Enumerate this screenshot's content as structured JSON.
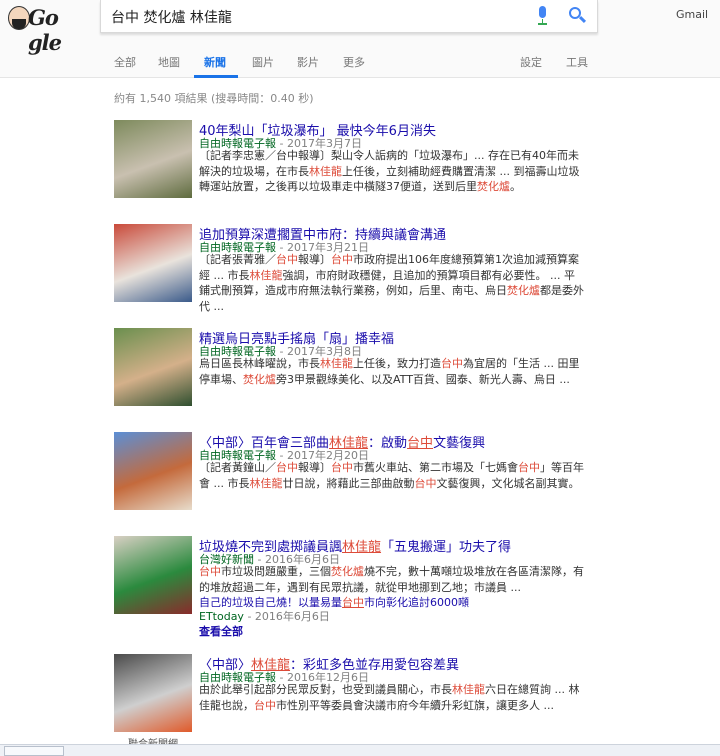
{
  "logo": {
    "text": "Go gle"
  },
  "search": {
    "query": "台中 焚化爐 林佳龍"
  },
  "header": {
    "gmail": "Gmail"
  },
  "tabs": {
    "all": "全部",
    "maps": "地圖",
    "news": "新聞",
    "images": "圖片",
    "videos": "影片",
    "more": "更多",
    "settings": "設定",
    "tools": "工具"
  },
  "stats": "約有 1,540 項結果 (搜尋時間：0.40 秒)",
  "results": [
    {
      "title": "40年梨山「垃圾瀑布」 最快今年6月消失",
      "source": "自由時報電子報",
      "date": "- 2017年3月7日",
      "snippet": [
        {
          "t": "〔記者李忠憲／台中報導〕梨山令人詬病的「垃圾瀑布」... 存在已有40年而未解決的垃圾場，在市長"
        },
        {
          "t": "林佳龍",
          "hl": true
        },
        {
          "t": "上任後，立刻補助經費購置清潔 ... 到福壽山垃圾轉運站放置，之後再以垃圾車走中橫隧37便道，送到后里"
        },
        {
          "t": "焚化爐",
          "hl": true
        },
        {
          "t": "。"
        }
      ],
      "thumb_colors": [
        "#7d8a5c",
        "#c9c0b0",
        "#5e6b3e"
      ]
    },
    {
      "title": "追加預算深遭擱置中市府：持續與議會溝通",
      "source": "自由時報電子報",
      "date": "- 2017年3月21日",
      "snippet": [
        {
          "t": "〔記者張菁雅／"
        },
        {
          "t": "台中",
          "hl": true
        },
        {
          "t": "報導〕"
        },
        {
          "t": "台中",
          "hl": true
        },
        {
          "t": "市政府提出106年度總預算第1次追加減預算案經 ... 市長"
        },
        {
          "t": "林佳龍",
          "hl": true
        },
        {
          "t": "強調，市府財政穩健，且追加的預算項目都有必要性。 ... 平鋪式刪預算，造成市府無法執行業務，例如，后里、南屯、烏日"
        },
        {
          "t": "焚化爐",
          "hl": true
        },
        {
          "t": "都是委外代 ..."
        }
      ],
      "thumb_colors": [
        "#c94a3a",
        "#e9e3dc",
        "#3a5a8a"
      ]
    },
    {
      "title": "精選烏日亮點手搖扇「扇」播幸福",
      "source": "自由時報電子報",
      "date": "- 2017年3月8日",
      "snippet": [
        {
          "t": "烏日區長林峰曜說，市長"
        },
        {
          "t": "林佳龍",
          "hl": true
        },
        {
          "t": "上任後，致力打造"
        },
        {
          "t": "台中",
          "hl": true
        },
        {
          "t": "為宜居的「生活 ... 田里停車場、"
        },
        {
          "t": "焚化爐",
          "hl": true
        },
        {
          "t": "旁3甲景觀綠美化、以及ATT百貨、國泰、新光人壽、烏日 ..."
        }
      ],
      "thumb_colors": [
        "#6a8f4e",
        "#d4b08a",
        "#2f4f2f"
      ]
    },
    {
      "title_parts": [
        {
          "t": "〈中部〉百年會三部曲"
        },
        {
          "t": "林佳龍",
          "ul": true
        },
        {
          "t": "：啟動"
        },
        {
          "t": "台中",
          "ul": true
        },
        {
          "t": "文藝復興"
        }
      ],
      "source": "自由時報電子報",
      "date": "- 2017年2月20日",
      "snippet": [
        {
          "t": "〔記者黃鐘山／"
        },
        {
          "t": "台中",
          "hl": true
        },
        {
          "t": "報導〕"
        },
        {
          "t": "台中",
          "hl": true
        },
        {
          "t": "市舊火車站、第二市場及「七媽會"
        },
        {
          "t": "台中",
          "hl": true
        },
        {
          "t": "」等百年會 ... 市長"
        },
        {
          "t": "林佳龍",
          "hl": true
        },
        {
          "t": "廿日說，將藉此三部曲啟動"
        },
        {
          "t": "台中",
          "hl": true
        },
        {
          "t": "文藝復興，文化城名副其實。"
        }
      ],
      "thumb_colors": [
        "#5b8fd6",
        "#c46a3c",
        "#e7dccb"
      ]
    },
    {
      "title_parts": [
        {
          "t": "垃圾燒不完到處掷議員諷"
        },
        {
          "t": "林佳龍",
          "ul": true
        },
        {
          "t": "「五鬼搬運」功夫了得"
        }
      ],
      "source": "台灣好新聞",
      "date": "- 2016年6月6日",
      "snippet": [
        {
          "t": "台中",
          "hl": true
        },
        {
          "t": "市垃圾問題嚴重，三個"
        },
        {
          "t": "焚化爐",
          "hl": true
        },
        {
          "t": "燒不完，數十萬噸垃圾堆放在各區清潔隊，有的堆放超過二年，遇到有民眾抗議，就從甲地挪到乙地；市議員 ..."
        }
      ],
      "sub_title_parts": [
        {
          "t": "自己的垃圾自己燒！以量易量"
        },
        {
          "t": "台中",
          "ul": true
        },
        {
          "t": "市向彰化追討6000噸"
        }
      ],
      "sub_source": "ETtoday",
      "sub_date": "- 2016年6月6日",
      "see_all": "查看全部",
      "thumb_colors": [
        "#d9d0c4",
        "#2b8a3e",
        "#8a2b2b"
      ]
    },
    {
      "title_parts": [
        {
          "t": "〈中部〉"
        },
        {
          "t": "林佳龍",
          "ul": true
        },
        {
          "t": "：彩虹多色並存用愛包容差異"
        }
      ],
      "source": "自由時報電子報",
      "date": "- 2016年12月6日",
      "snippet": [
        {
          "t": "由於此舉引起部分民眾反對，也受到議員關心，市長"
        },
        {
          "t": "林佳龍",
          "hl": true
        },
        {
          "t": "六日在總質詢 ... 林佳龍也說，"
        },
        {
          "t": "台中",
          "hl": true
        },
        {
          "t": "市性別平等委員會決議市府今年續升彩虹旗，讓更多人 ..."
        }
      ],
      "caption": "聯合新聞網",
      "thumb_colors": [
        "#4a4a4a",
        "#cfcfcf",
        "#e05a2a"
      ]
    }
  ]
}
